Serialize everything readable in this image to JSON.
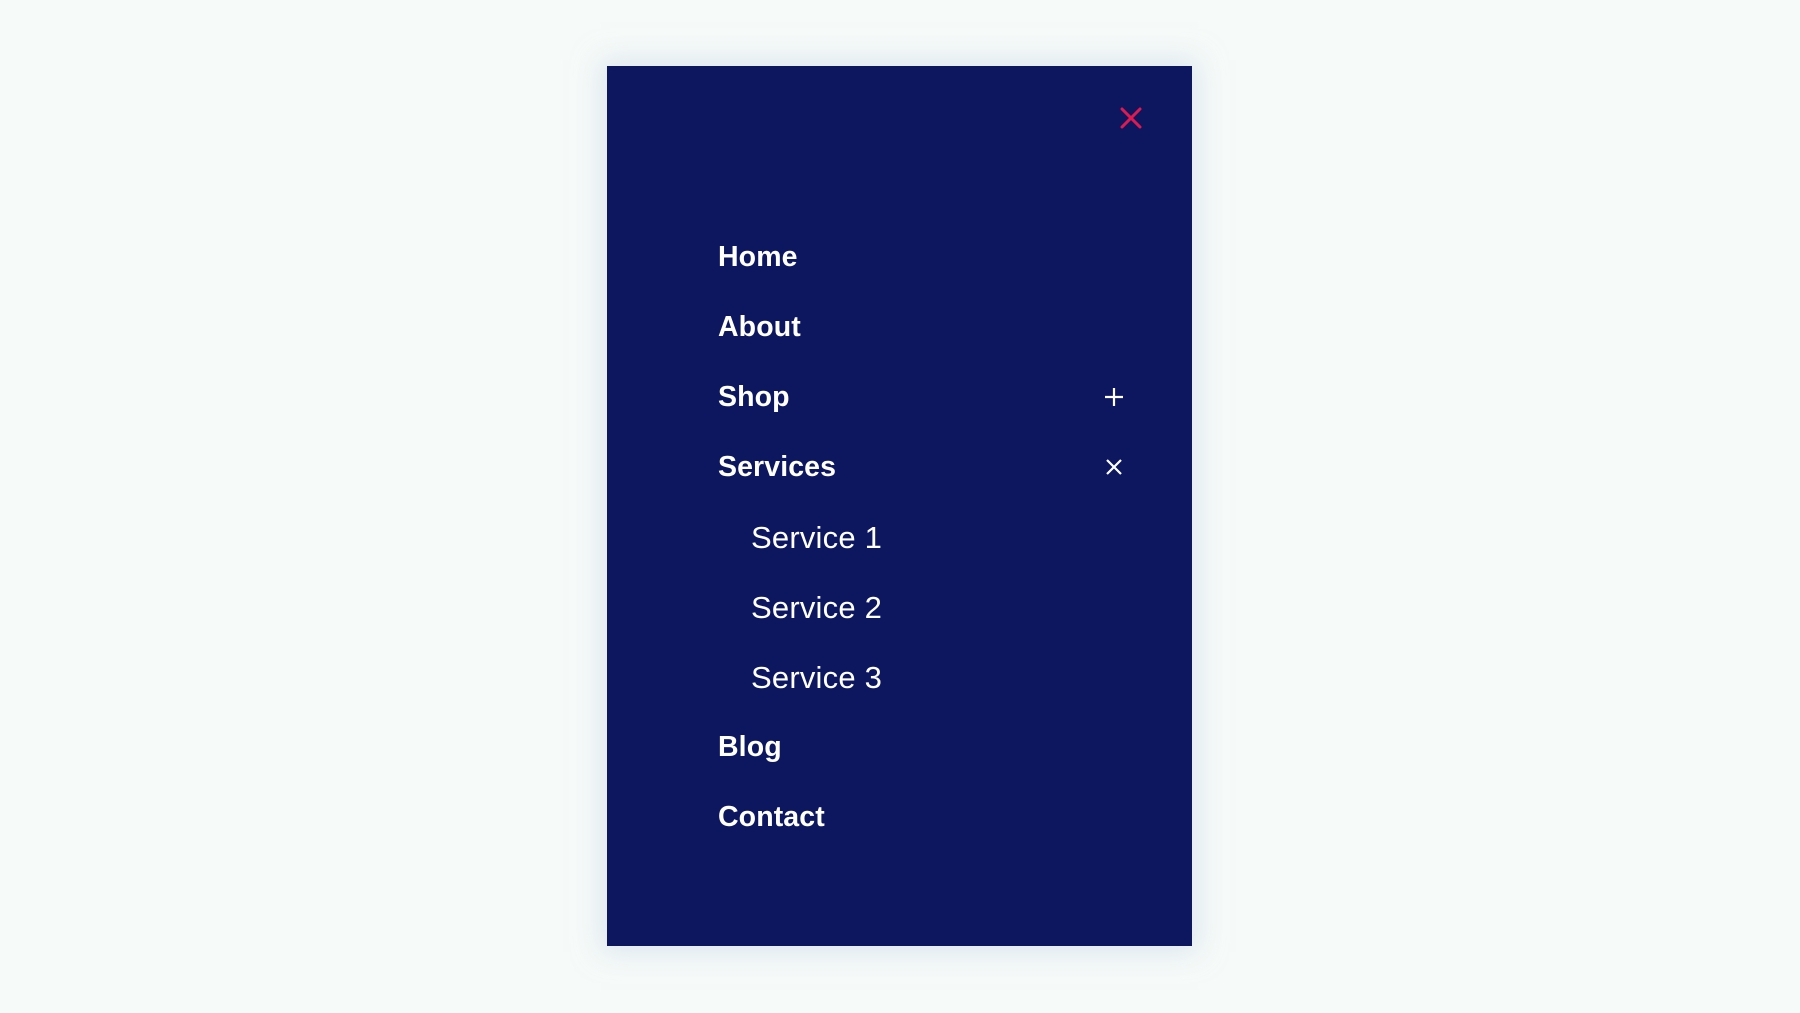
{
  "page": {
    "background_color": "#f6faf8"
  },
  "menu_panel": {
    "background_color": "#0c1760",
    "text_color": "#ffffff",
    "accent_color": "#e0194f",
    "close_button": {
      "icon": "close-icon",
      "label": "Close menu",
      "color": "#e0194f"
    }
  },
  "nav": {
    "items": [
      {
        "label": "Home",
        "has_toggle": false,
        "expanded": false,
        "toggle_icon": "",
        "children": []
      },
      {
        "label": "About",
        "has_toggle": false,
        "expanded": false,
        "toggle_icon": "",
        "children": []
      },
      {
        "label": "Shop",
        "has_toggle": true,
        "expanded": false,
        "toggle_icon": "plus-icon",
        "children": []
      },
      {
        "label": "Services",
        "has_toggle": true,
        "expanded": true,
        "toggle_icon": "close-icon",
        "children": [
          {
            "label": "Service 1"
          },
          {
            "label": "Service 2"
          },
          {
            "label": "Service 3"
          }
        ]
      },
      {
        "label": "Blog",
        "has_toggle": false,
        "expanded": false,
        "toggle_icon": "",
        "children": []
      },
      {
        "label": "Contact",
        "has_toggle": false,
        "expanded": false,
        "toggle_icon": "",
        "children": []
      }
    ]
  }
}
